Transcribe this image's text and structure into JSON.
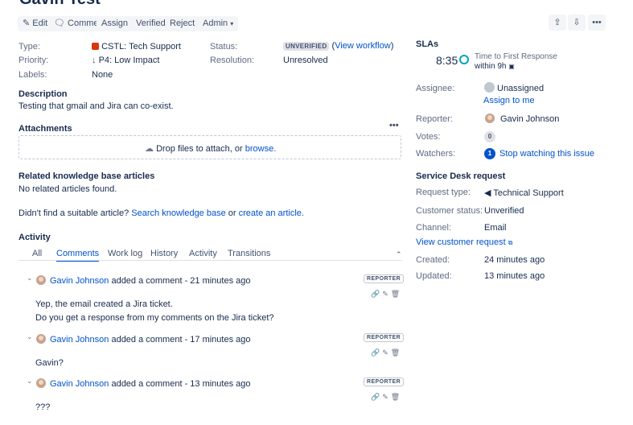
{
  "issue": {
    "title": "Gavin Test"
  },
  "toolbar": {
    "edit": "Edit",
    "comment": "Comment",
    "assign": "Assign",
    "verified": "Verified",
    "reject": "Reject",
    "admin": "Admin"
  },
  "details": {
    "type_label": "Type:",
    "type_value": "CSTL: Tech Support",
    "status_label": "Status:",
    "status_value": "UNVERIFIED",
    "status_link_open": "(",
    "status_link": "View workflow",
    "status_link_close": ")",
    "priority_label": "Priority:",
    "priority_value": "P4: Low Impact",
    "resolution_label": "Resolution:",
    "resolution_value": "Unresolved",
    "labels_label": "Labels:",
    "labels_value": "None"
  },
  "description": {
    "heading": "Description",
    "text": "Testing that gmail and Jira can co-exist."
  },
  "attachments": {
    "heading": "Attachments",
    "drop_text": "Drop files to attach, or ",
    "browse": "browse."
  },
  "kb": {
    "heading": "Related knowledge base articles",
    "none": "No related articles found.",
    "prompt": "Didn't find a suitable article?",
    "search_link": "Search knowledge base",
    "or": "or",
    "create_link": "create an article."
  },
  "activity": {
    "heading": "Activity",
    "tabs": [
      "All",
      "Comments",
      "Work log",
      "History",
      "Activity",
      "Transitions"
    ],
    "active_tab": "Comments",
    "comments": [
      {
        "author": "Gavin Johnson",
        "meta": "added a comment - 21 minutes ago",
        "badge": "REPORTER",
        "lines": [
          "Yep, the email created a Jira ticket.",
          "Do you get a response from my comments on the Jira ticket?"
        ]
      },
      {
        "author": "Gavin Johnson",
        "meta": "added a comment - 17 minutes ago",
        "badge": "REPORTER",
        "lines": [
          "Gavin?"
        ]
      },
      {
        "author": "Gavin Johnson",
        "meta": "added a comment - 13 minutes ago",
        "badge": "REPORTER",
        "lines": [
          "???"
        ]
      }
    ]
  },
  "sla": {
    "heading": "SLAs",
    "time": "8:35",
    "name": "Time to First Response",
    "within": "within 9h"
  },
  "people": {
    "assignee_label": "Assignee:",
    "assignee_value": "Unassigned",
    "assign_to_me": "Assign to me",
    "reporter_label": "Reporter:",
    "reporter_value": "Gavin Johnson",
    "votes_label": "Votes:",
    "votes_value": "0",
    "watchers_label": "Watchers:",
    "watchers_value": "1",
    "watch_link": "Stop watching this issue"
  },
  "service_desk": {
    "heading": "Service Desk request",
    "request_type_label": "Request type:",
    "request_type_value": "Technical Support",
    "customer_status_label": "Customer status:",
    "customer_status_value": "Unverified",
    "channel_label": "Channel:",
    "channel_value": "Email",
    "view_request": "View customer request"
  },
  "dates": {
    "created_label": "Created:",
    "created_value": "24 minutes ago",
    "updated_label": "Updated:",
    "updated_value": "13 minutes ago"
  },
  "colors": {
    "link": "#0052cc",
    "text": "#172b4d",
    "muted": "#5e6c84",
    "button_bg": "#f4f5f7",
    "sla_icon": "#00a3bf",
    "type_icon": "#de350b"
  }
}
